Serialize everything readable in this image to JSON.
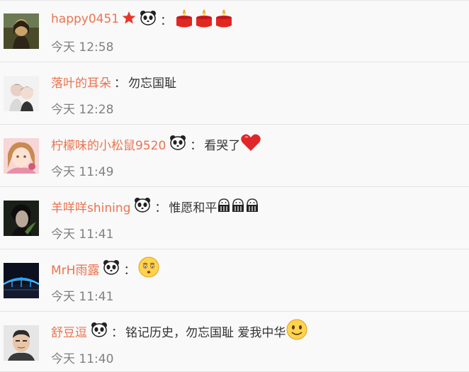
{
  "colors": {
    "username": "#eb7350",
    "text": "#333333",
    "time": "#808080",
    "divider": "#e3e3e3",
    "background": "#f9f9f9"
  },
  "comments": [
    {
      "user": "happy0451",
      "badges": [
        "star-icon",
        "panda-icon"
      ],
      "separator": "：",
      "text": "",
      "emoji": [
        "candle-icon",
        "candle-icon",
        "candle-icon"
      ],
      "time": "今天 12:58"
    },
    {
      "user": "落叶的耳朵",
      "badges": [],
      "separator": "：",
      "text": "勿忘国耻",
      "emoji": [],
      "time": "今天 12:28"
    },
    {
      "user": "柠檬味的小松鼠9520",
      "badges": [
        "panda-icon"
      ],
      "separator": "：",
      "text": "看哭了",
      "emoji": [
        "heart-icon"
      ],
      "time": "今天 11:49"
    },
    {
      "user": "羊咩咩shining",
      "badges": [
        "panda-icon"
      ],
      "separator": "：",
      "text": "惟愿和平",
      "emoji": [
        "salute-icon",
        "salute-icon",
        "salute-icon"
      ],
      "time": "今天 11:41"
    },
    {
      "user": "MrH雨露",
      "badges": [
        "panda-icon"
      ],
      "separator": "：",
      "text": "",
      "emoji": [
        "worried-face-icon"
      ],
      "time": "今天 11:41"
    },
    {
      "user": "舒豆逗",
      "badges": [
        "panda-icon"
      ],
      "separator": "：",
      "text": "铭记历史，勿忘国耻 爱我中华",
      "emoji": [
        "smile-face-icon"
      ],
      "time": "今天 11:40"
    }
  ]
}
